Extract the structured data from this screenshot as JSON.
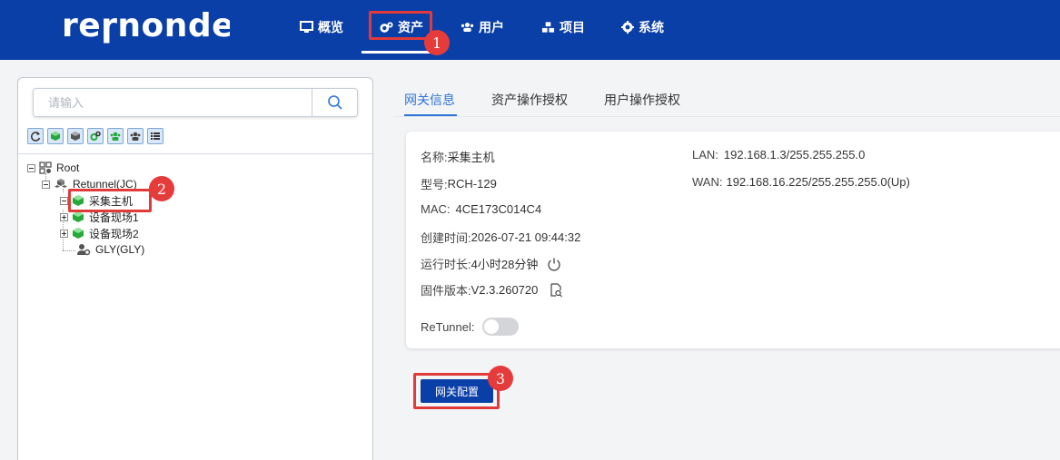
{
  "brand": {
    "logo_text": "reɼnonde"
  },
  "nav": {
    "items": [
      {
        "label": "概览",
        "icon": "monitor-icon"
      },
      {
        "label": "资产",
        "icon": "cogs-icon"
      },
      {
        "label": "用户",
        "icon": "users-icon"
      },
      {
        "label": "项目",
        "icon": "cubes-icon"
      },
      {
        "label": "系统",
        "icon": "gear-icon"
      }
    ],
    "active": "资产"
  },
  "annotations": [
    "1",
    "2",
    "3"
  ],
  "sidebar": {
    "search_placeholder": "请输入",
    "toolbar_icons": [
      "refresh-icon",
      "gateway-icon",
      "site-icon",
      "assets-icon",
      "users-icon",
      "group-icon",
      "list-icon"
    ],
    "tree": [
      {
        "label": "Root",
        "icon": "grid-icon"
      },
      {
        "label": "Retunnel(JC)",
        "icon": "network-icon"
      },
      {
        "label": "采集主机",
        "icon": "gateway-icon",
        "selected": true
      },
      {
        "label": "设备现场1",
        "icon": "site-icon"
      },
      {
        "label": "设备现场2",
        "icon": "site-icon"
      },
      {
        "label": "GLY(GLY)",
        "icon": "user-gear-icon"
      }
    ]
  },
  "tabs": [
    {
      "label": "网关信息",
      "active": true
    },
    {
      "label": "资产操作授权",
      "active": false
    },
    {
      "label": "用户操作授权",
      "active": false
    }
  ],
  "gateway_info": {
    "name_label": "名称:",
    "name": "采集主机",
    "model_label": "型号:",
    "model": "RCH-129",
    "mac_label": "MAC:",
    "mac": "4CE173C014C4",
    "created_label": "创建时间:",
    "created": "2026-07-21 09:44:32",
    "uptime_label": "运行时长:",
    "uptime": "4小时28分钟",
    "firmware_label": "固件版本:",
    "firmware": "V2.3.260720",
    "retunnel_label": "ReTunnel:",
    "retunnel_enabled": false,
    "lan_label": "LAN:",
    "lan": "192.168.1.3/255.255.255.0",
    "wan_label": "WAN:",
    "wan": "192.168.16.225/255.255.255.0(Up)"
  },
  "actions": {
    "config_button": "网关配置"
  }
}
